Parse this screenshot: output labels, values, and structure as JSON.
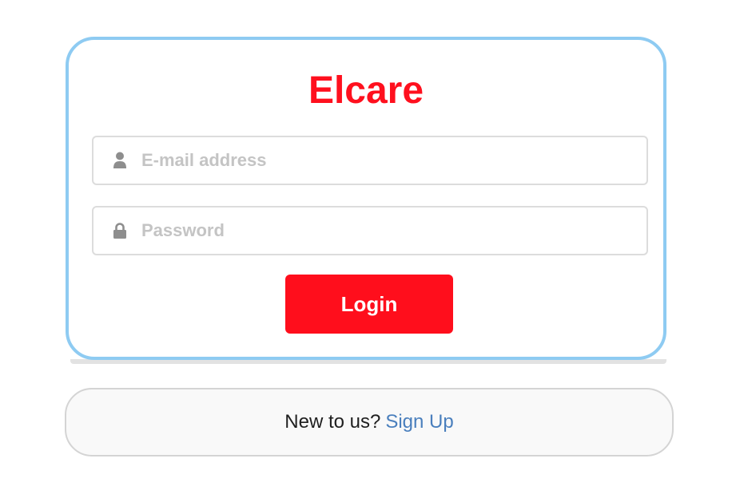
{
  "brand": {
    "title": "Elcare",
    "color": "#ff101e"
  },
  "form": {
    "email": {
      "placeholder": "E-mail address",
      "value": "",
      "icon": "user-icon"
    },
    "password": {
      "placeholder": "Password",
      "value": "",
      "icon": "lock-icon"
    },
    "login_label": "Login"
  },
  "signup": {
    "prompt": "New to us?",
    "link_label": "Sign Up"
  },
  "colors": {
    "card_border": "#8ecbf2",
    "button": "#ff0e1c",
    "link": "#4a7fbd",
    "placeholder": "#c4c4c4",
    "icon": "#8e8e8e"
  }
}
